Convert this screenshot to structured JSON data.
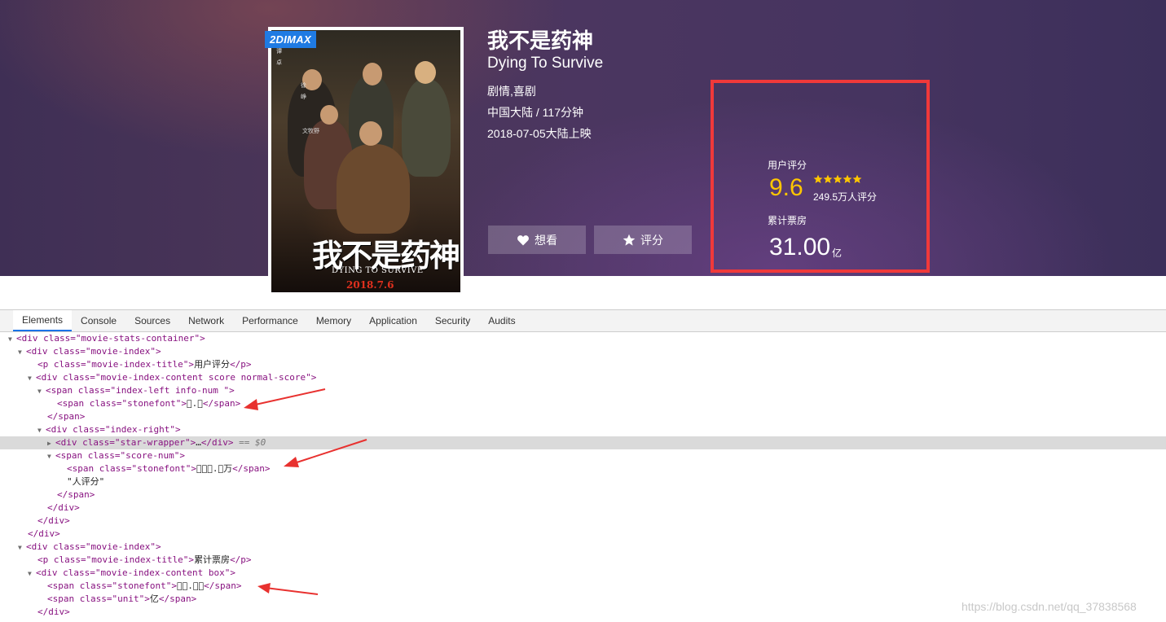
{
  "movie": {
    "badge": "2DIMAX",
    "title": "我不是药神",
    "title_en": "Dying To Survive",
    "genre": "剧情,喜剧",
    "region_duration": "中国大陆 / 117分钟",
    "release": "2018-07-05大陆上映",
    "poster": {
      "title": "我不是药神",
      "subtitle": "DYING TO SURVIVE",
      "date": "2018.7.6",
      "cast_a": [
        "谭",
        "卓"
      ],
      "cast_b": [
        "徐",
        "峥"
      ],
      "cast_c": [
        "文牧野"
      ]
    }
  },
  "actions": {
    "want_label": "想看",
    "rate_label": "评分"
  },
  "stats": {
    "user_score_title": "用户评分",
    "score": "9.6",
    "stars": 5,
    "score_count": "249.5万人评分",
    "box_office_title": "累计票房",
    "box_office": "31.00",
    "box_office_unit": "亿"
  },
  "colors": {
    "highlight_border": "#f0393a",
    "score_color": "#ffc600",
    "badge_color": "#1f7be3",
    "arrow_color": "#e8312f"
  },
  "devtools": {
    "tabs": [
      "Elements",
      "Console",
      "Sources",
      "Network",
      "Performance",
      "Memory",
      "Application",
      "Security",
      "Audits"
    ],
    "active_tab": "Elements",
    "lines": {
      "l1": "<div class=\"movie-stats-container\">",
      "l2": "<div class=\"movie-index\">",
      "l3_open": "<p class=\"movie-index-title\">",
      "l3_text": "用户评分",
      "l3_close": "</p>",
      "l4": "<div class=\"movie-index-content score normal-score\">",
      "l5": "<span class=\"index-left info-num \">",
      "l6_open": "<span class=\"stonefont\">",
      "l6_text": ".",
      "l6_close": "</span>",
      "l7": "</span>",
      "l8": "<div class=\"index-right\">",
      "l9_open": "<div class=\"star-wrapper\">",
      "l9_ell": "…",
      "l9_close": "</div>",
      "l9_dollar": " == $0",
      "l10": "<span class=\"score-num\">",
      "l11_open": "<span class=\"stonefont\">",
      "l11_text": ".万",
      "l11_close": "</span>",
      "l12": "\"人评分\"",
      "l13": "</span>",
      "l14": "</div>",
      "l15": "</div>",
      "l16": "</div>",
      "l17": "<div class=\"movie-index\">",
      "l18_open": "<p class=\"movie-index-title\">",
      "l18_text": "累计票房",
      "l18_close": "</p>",
      "l19": "<div class=\"movie-index-content box\">",
      "l20_open": "<span class=\"stonefont\">",
      "l20_text": ".",
      "l20_close": "</span>",
      "l21_open": "<span class=\"unit\">",
      "l21_text": "亿",
      "l21_close": "</span>",
      "l22": "</div>"
    }
  },
  "watermark": "https://blog.csdn.net/qq_37838568"
}
